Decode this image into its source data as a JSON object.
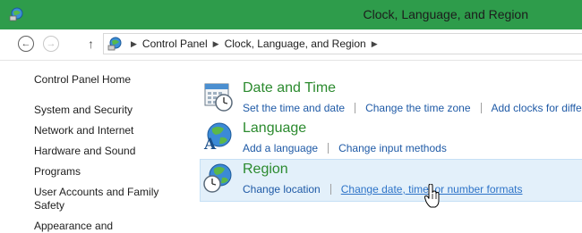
{
  "window": {
    "title": "Clock, Language, and Region"
  },
  "navigation": {
    "back_icon": "arrow-left",
    "forward_icon": "arrow-right",
    "up_icon": "arrow-up",
    "breadcrumbs": [
      "Control Panel",
      "Clock, Language, and Region"
    ]
  },
  "sidebar": {
    "items": [
      {
        "label": "Control Panel Home"
      },
      {
        "label": "System and Security"
      },
      {
        "label": "Network and Internet"
      },
      {
        "label": "Hardware and Sound"
      },
      {
        "label": "Programs"
      },
      {
        "label": "User Accounts and Family"
      },
      {
        "label": "Safety"
      },
      {
        "label": "Appearance and"
      }
    ]
  },
  "categories": [
    {
      "title": "Date and Time",
      "icon": "calendar-clock-icon",
      "links": [
        "Set the time and date",
        "Change the time zone",
        "Add clocks for differ"
      ]
    },
    {
      "title": "Language",
      "icon": "globe-language-icon",
      "links": [
        "Add a language",
        "Change input methods"
      ]
    },
    {
      "title": "Region",
      "icon": "globe-clock-icon",
      "links": [
        "Change location",
        "Change date, time, or number formats"
      ]
    }
  ],
  "colors": {
    "titlebar": "#2e9c4b",
    "category_title": "#2b8a2e",
    "link": "#1f5aa6",
    "highlight": "#e3f0fa"
  }
}
